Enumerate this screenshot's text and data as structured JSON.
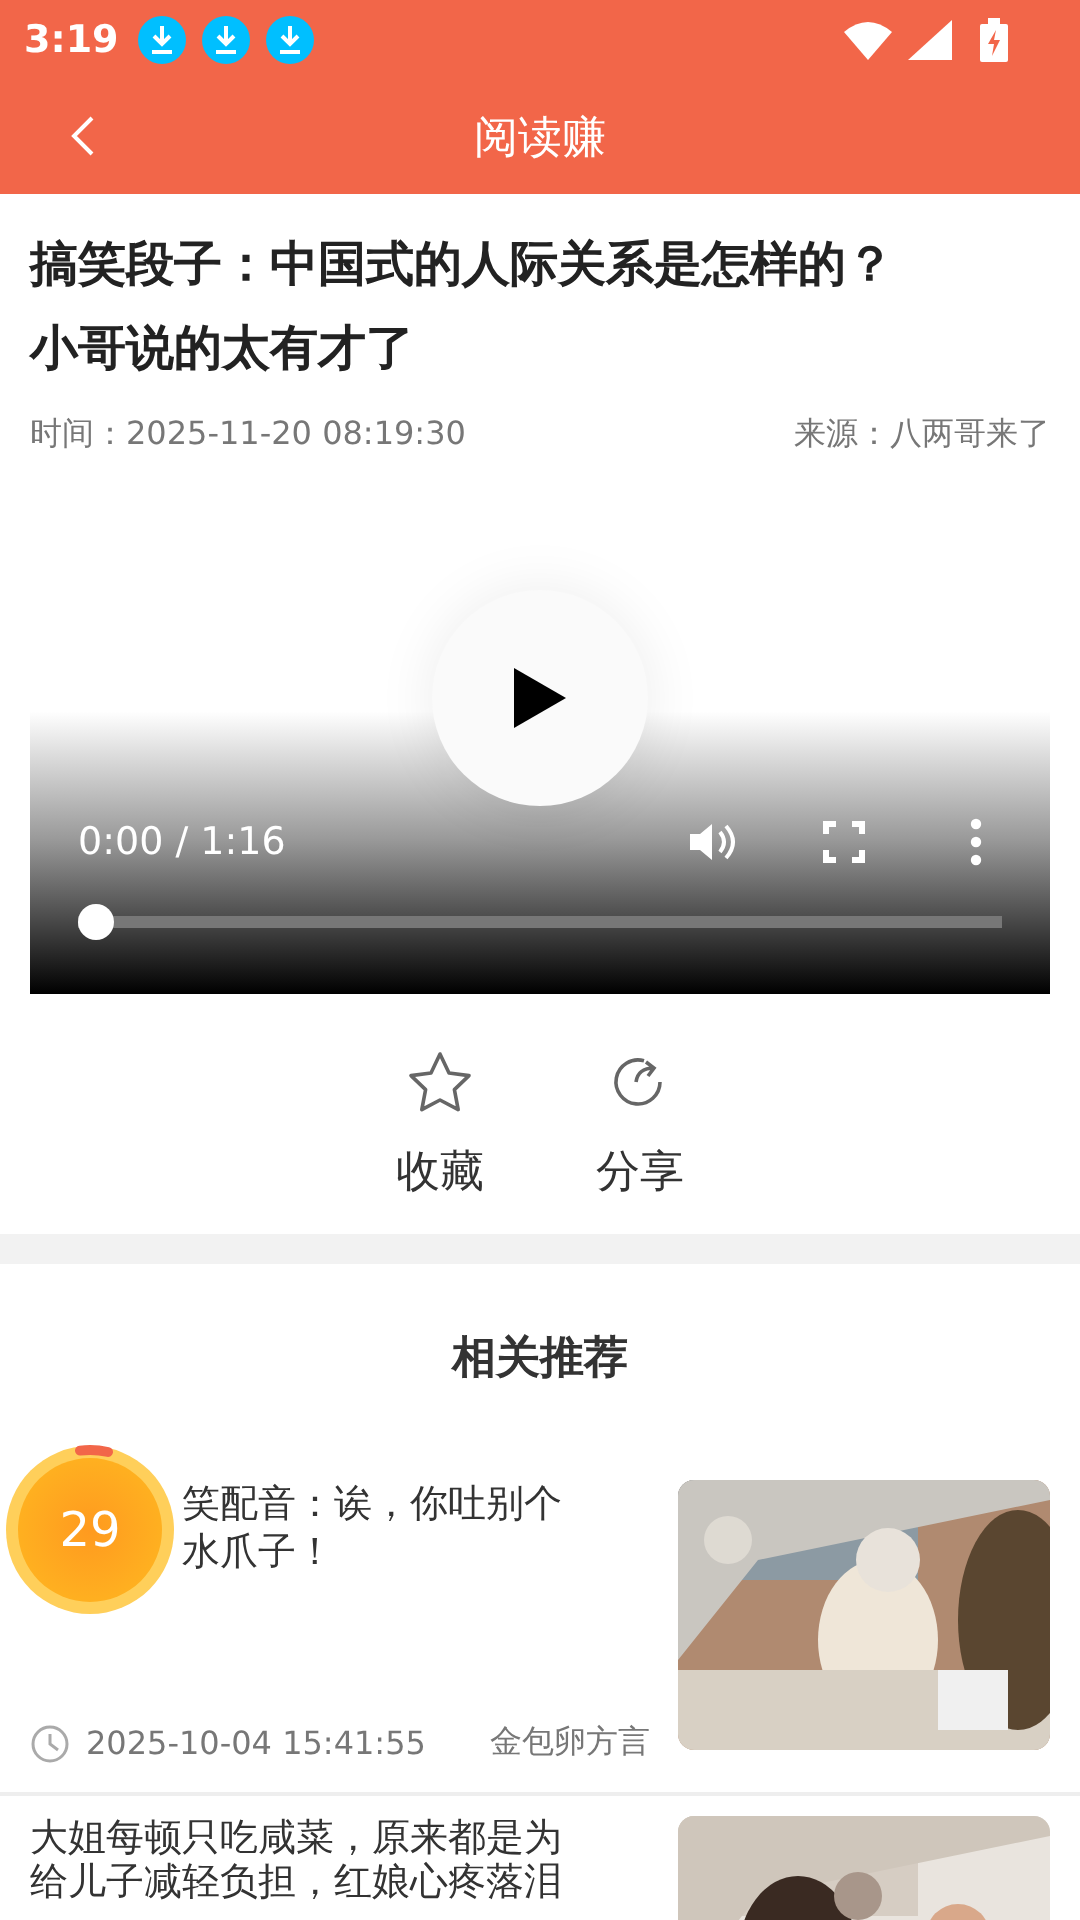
{
  "status_bar": {
    "time": "3:19",
    "notifications": [
      {
        "kind": "download"
      },
      {
        "kind": "download"
      },
      {
        "kind": "download"
      }
    ]
  },
  "app_bar": {
    "title": "阅读赚"
  },
  "article": {
    "title_lines": [
      "搞笑段子：中国式的人际关系是怎样的？",
      "小哥说的太有才了"
    ],
    "time": "时间：2025-11-20 08:19:30",
    "source": "来源：八两哥来了"
  },
  "video": {
    "time": "0:00 / 1:16",
    "level": 0
  },
  "actions": [
    {
      "kind": "favorite",
      "label": "收藏"
    },
    {
      "kind": "share",
      "label": "分享"
    }
  ],
  "related": {
    "heading": "相关推荐",
    "items": [
      {
        "title_lines": [
          "笑配音：诶，你吐别个",
          "水爪子！"
        ],
        "date": "2025-10-04 15:41:55",
        "source": "金包卵方言",
        "kind": "picture"
      },
      {
        "title_lines": [
          "大姐每顿只吃咸菜，原来都是为",
          "给儿子减轻负担，红娘心疼落泪"
        ],
        "kind": "picture"
      }
    ]
  },
  "timer": {
    "count": "29"
  }
}
